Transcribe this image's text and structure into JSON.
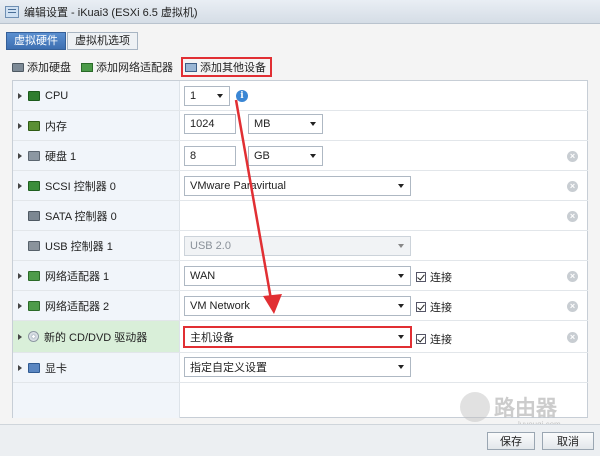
{
  "window": {
    "title": "编辑设置 - iKuai3 (ESXi 6.5 虚拟机)"
  },
  "tabs": [
    {
      "label": "虚拟硬件"
    },
    {
      "label": "虚拟机选项"
    }
  ],
  "toolbar": {
    "add_disk": "添加硬盘",
    "add_nic": "添加网络适配器",
    "add_other": "添加其他设备"
  },
  "rows": {
    "cpu": {
      "label": "CPU",
      "value": "1"
    },
    "memory": {
      "label": "内存",
      "value": "1024",
      "unit": "MB"
    },
    "disk": {
      "label": "硬盘 1",
      "value": "8",
      "unit": "GB"
    },
    "scsi": {
      "label": "SCSI 控制器 0",
      "value": "VMware Paravirtual"
    },
    "sata": {
      "label": "SATA 控制器 0"
    },
    "usb": {
      "label": "USB 控制器 1",
      "value": "USB 2.0"
    },
    "nic1": {
      "label": "网络适配器 1",
      "value": "WAN",
      "connect": "连接"
    },
    "nic2": {
      "label": "网络适配器 2",
      "value": "VM Network",
      "connect": "连接"
    },
    "cd": {
      "label": "新的 CD/DVD 驱动器",
      "value": "主机设备",
      "connect": "连接"
    },
    "video": {
      "label": "显卡",
      "value": "指定自定义设置"
    }
  },
  "footer": {
    "save": "保存",
    "cancel": "取消"
  },
  "watermark": {
    "text": "路由器",
    "sub": "luyouqi.com"
  },
  "colors": {
    "highlight": "#e12f33",
    "tab_active": "#3d6fb1"
  }
}
